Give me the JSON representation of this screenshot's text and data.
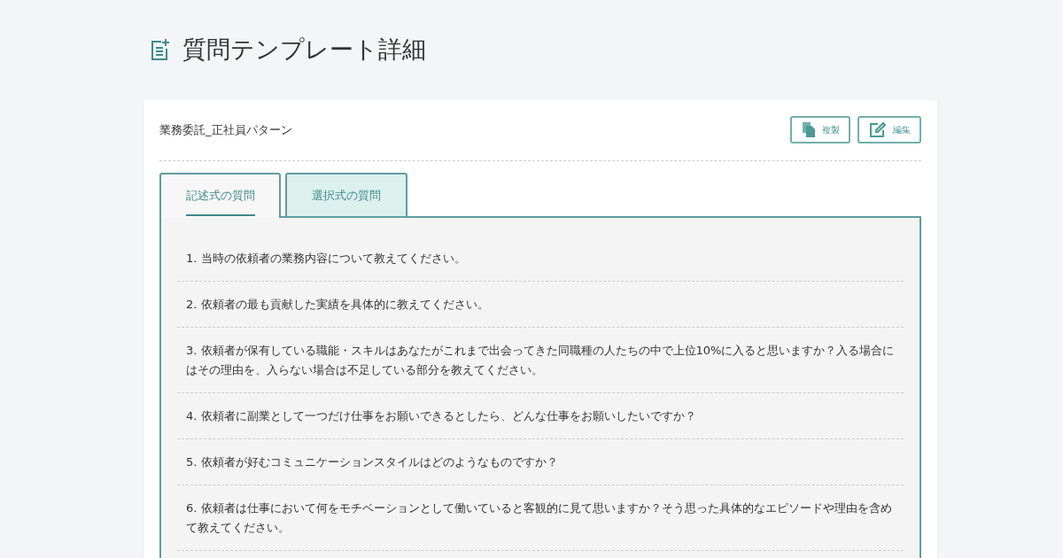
{
  "page_title": "質問テンプレート詳細",
  "template_name": "業務委託_正社員パターン",
  "buttons": [
    {
      "kind": "copy",
      "label": "複製"
    },
    {
      "kind": "edit",
      "label": "編集"
    }
  ],
  "tabs": [
    {
      "label": "記述式の質問",
      "selected": true
    },
    {
      "label": "選択式の質問",
      "selected": false
    }
  ],
  "questions": [
    "1. 当時の依頼者の業務内容について教えてください。",
    "2. 依頼者の最も貢献した実績を具体的に教えてください。",
    "3. 依頼者が保有している職能・スキルはあなたがこれまで出会ってきた同職種の人たちの中で上位10%に入ると思いますか？入る場合にはその理由を、入らない場合は不足している部分を教えてください。",
    "4. 依頼者に副業として一つだけ仕事をお願いできるとしたら、どんな仕事をお願いしたいですか？",
    "5. 依頼者が好むコミュニケーションスタイルはどのようなものですか？",
    "6. 依頼者は仕事において何をモチベーションとして働いていると客観的に見て思いますか？そう思った具体的なエピソードや理由を含めて教えてください。"
  ]
}
